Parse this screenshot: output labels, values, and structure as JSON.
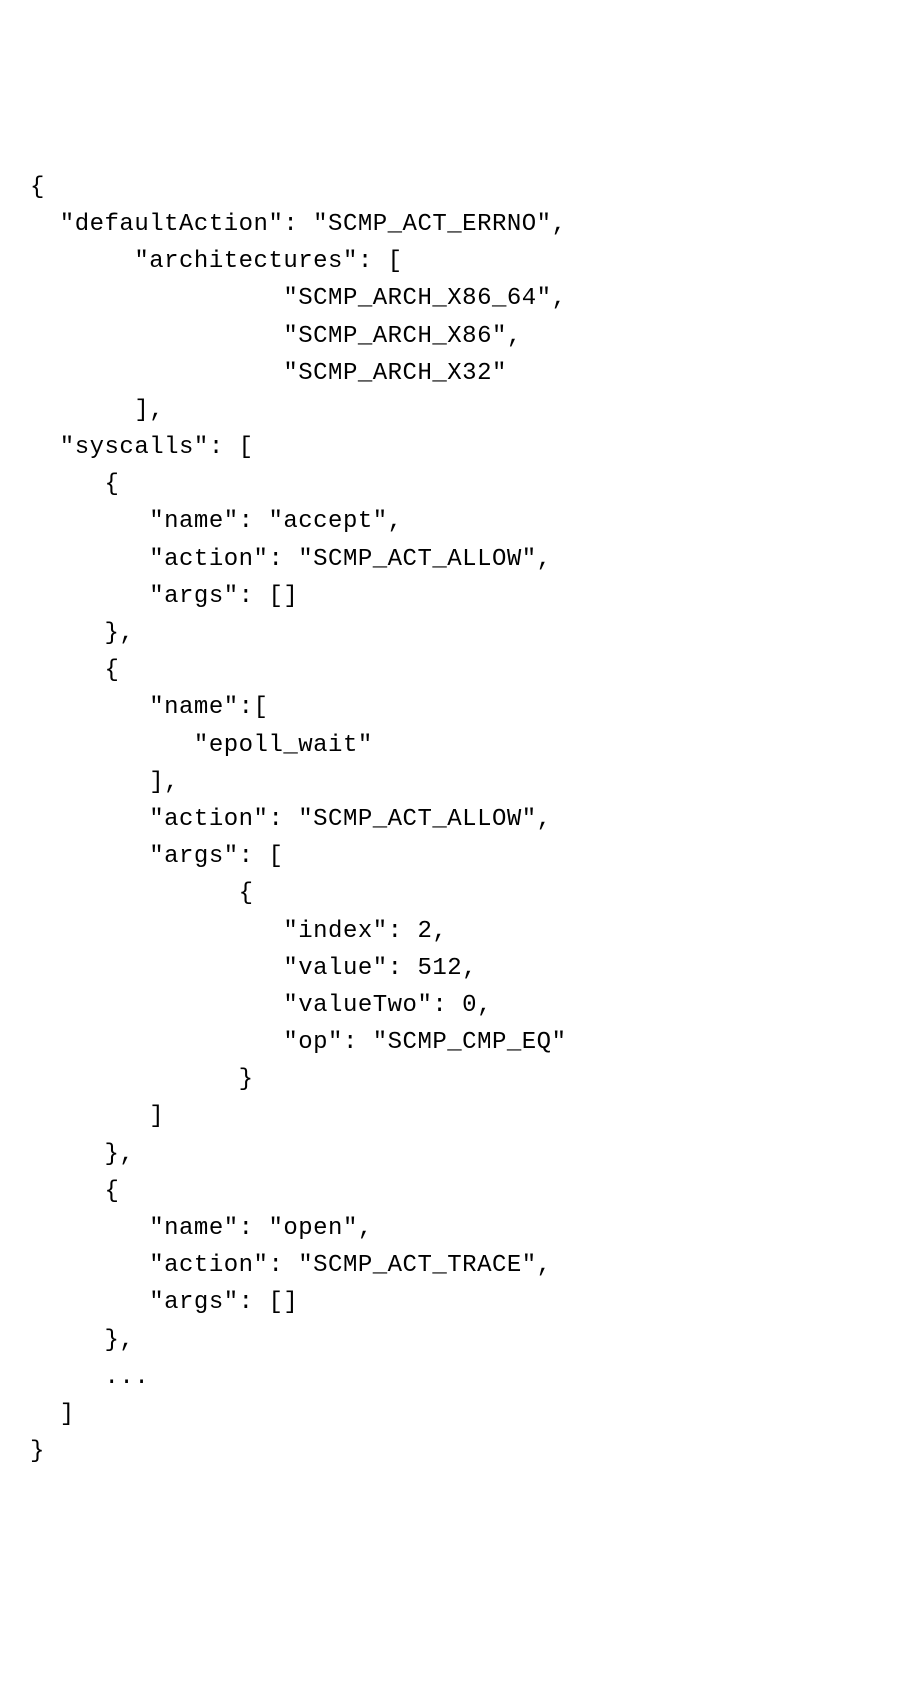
{
  "code": "{\n  \"defaultAction\": \"SCMP_ACT_ERRNO\",\n       \"architectures\": [\n                 \"SCMP_ARCH_X86_64\",\n                 \"SCMP_ARCH_X86\",\n                 \"SCMP_ARCH_X32\"\n       ],\n  \"syscalls\": [\n     {\n        \"name\": \"accept\",\n        \"action\": \"SCMP_ACT_ALLOW\",\n        \"args\": []\n     },\n     {\n        \"name\":[\n           \"epoll_wait\"\n        ],\n        \"action\": \"SCMP_ACT_ALLOW\",\n        \"args\": [\n              {\n                 \"index\": 2,\n                 \"value\": 512,\n                 \"valueTwo\": 0,\n                 \"op\": \"SCMP_CMP_EQ\"\n              }\n        ]\n     },\n     {\n        \"name\": \"open\",\n        \"action\": \"SCMP_ACT_TRACE\",\n        \"args\": []\n     },\n     ...\n  ]\n}"
}
